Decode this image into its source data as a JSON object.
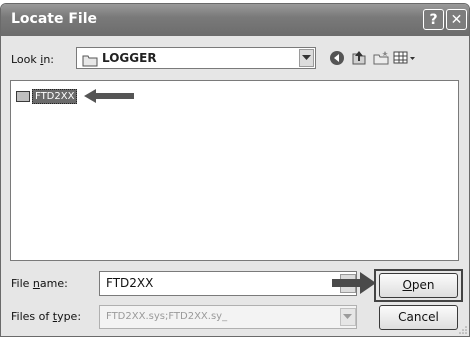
{
  "window": {
    "title": "Locate File",
    "help_glyph": "?",
    "close_glyph": "✕"
  },
  "look_in": {
    "label_pre": "Look ",
    "label_key": "i",
    "label_post": "n:",
    "value": "LOGGER"
  },
  "toolbar": {
    "icons": [
      "back-icon",
      "up-folder-icon",
      "new-folder-icon",
      "views-menu-icon"
    ]
  },
  "files": [
    {
      "name": "FTD2XX",
      "selected": true
    }
  ],
  "file_name": {
    "label_pre": "File ",
    "label_key": "n",
    "label_post": "ame:",
    "value": "FTD2XX"
  },
  "file_type": {
    "label_pre": "Files of ",
    "label_key": "t",
    "label_post": "ype:",
    "value": "FTD2XX.sys;FTD2XX.sy_"
  },
  "buttons": {
    "open_key": "O",
    "open_rest": "pen",
    "cancel": "Cancel"
  },
  "colors": {
    "titlebar": "#7a7a7a",
    "selection": "#6b6b6b",
    "dialog_bg": "#e6e6e6"
  }
}
